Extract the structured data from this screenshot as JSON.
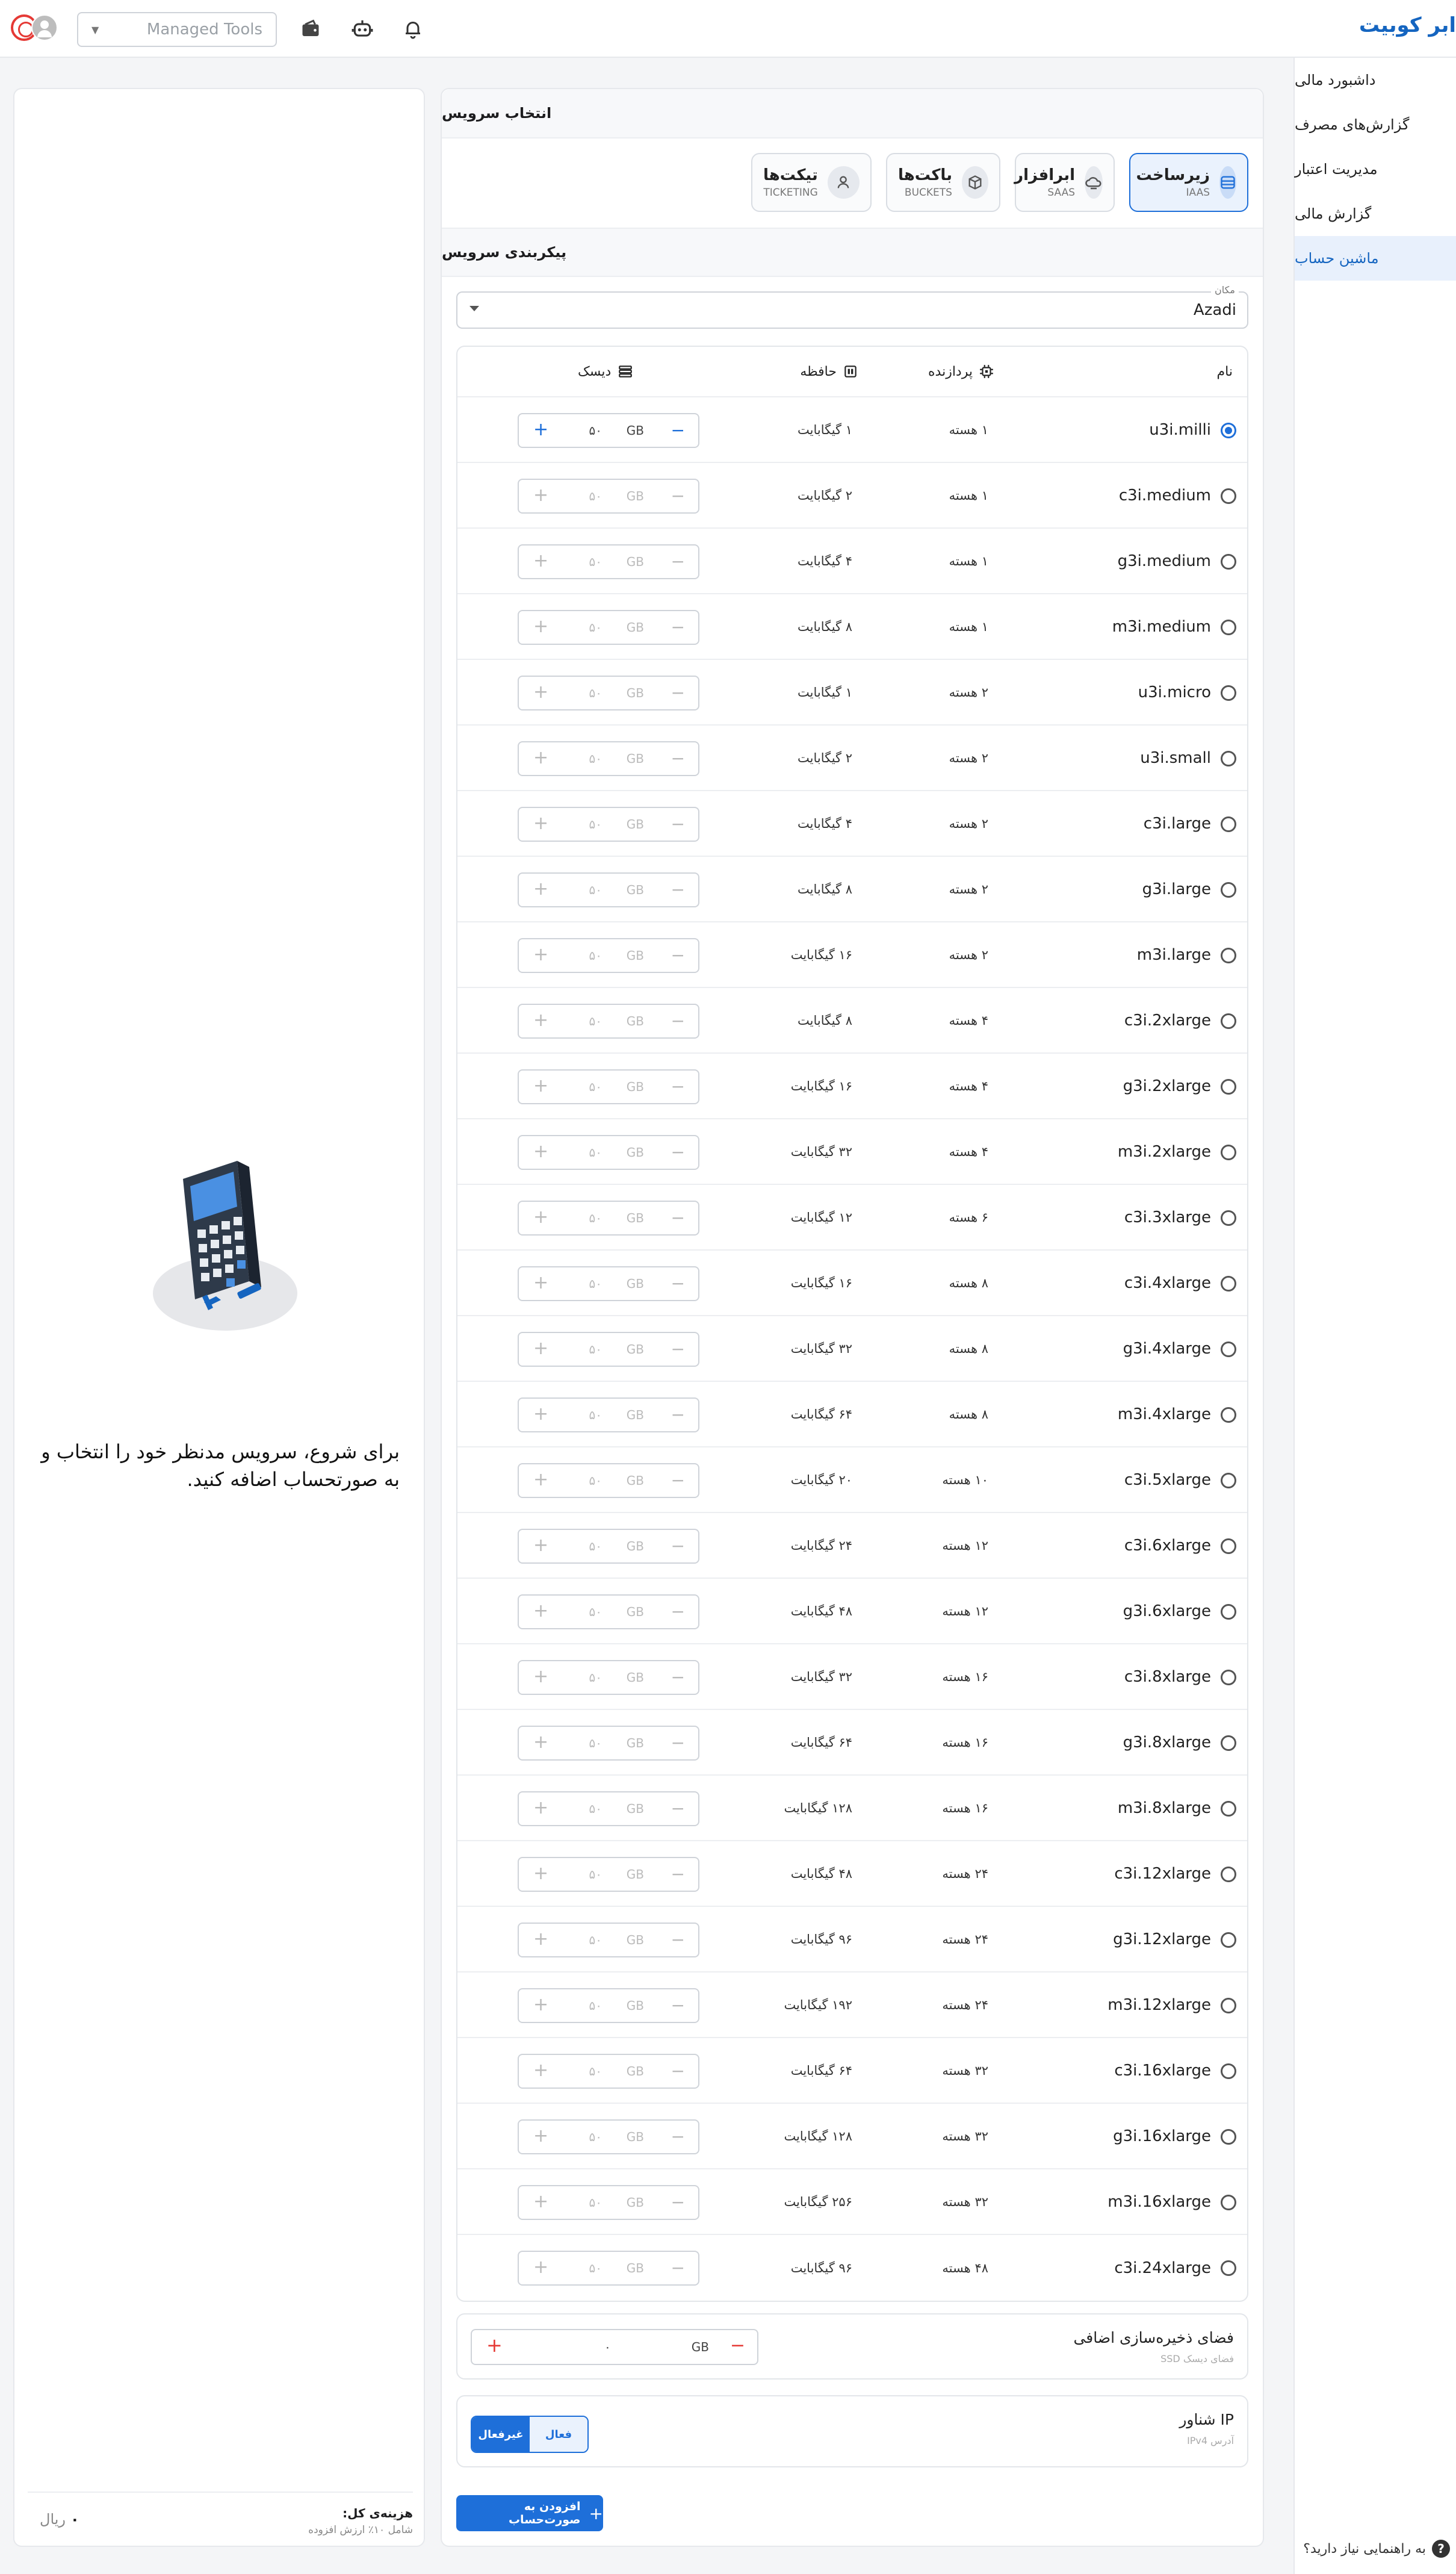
{
  "header": {
    "brand": "ابر کوبیت",
    "tools_placeholder": "Managed Tools"
  },
  "sidebar": {
    "items": [
      {
        "label": "داشبورد مالی",
        "active": false
      },
      {
        "label": "گزارش‌های مصرف",
        "active": false
      },
      {
        "label": "مدیریت اعتبار",
        "active": false
      },
      {
        "label": "گزارش مالی",
        "active": false
      },
      {
        "label": "ماشین حساب",
        "active": true
      }
    ],
    "help": "به راهنمایی نیاز دارید؟"
  },
  "main": {
    "select_service_title": "انتخاب سرویس",
    "categories": [
      {
        "title": "زیرساخت",
        "sub": "IAAS",
        "icon": "server-icon",
        "selected": true
      },
      {
        "title": "ابرافزار",
        "sub": "SAAS",
        "icon": "cloud-icon",
        "selected": false
      },
      {
        "title": "باکت‌ها",
        "sub": "BUCKETS",
        "icon": "box-icon",
        "selected": false
      },
      {
        "title": "تیکت‌ها",
        "sub": "TICKETING",
        "icon": "user-icon",
        "selected": false
      }
    ],
    "config_title": "پیکربندی سرویس",
    "location": {
      "label": "مکان",
      "value": "Azadi"
    },
    "table": {
      "headers": {
        "name": "نام",
        "cpu": "پردازنده",
        "memory": "حافظه",
        "disk": "دیسک"
      },
      "disk_unit": "GB",
      "rows": [
        {
          "name": "u3i.milli",
          "cpu": "۱ هسته",
          "mem": "۱ گیگابایت",
          "disk": "۵۰",
          "selected": true
        },
        {
          "name": "c3i.medium",
          "cpu": "۱ هسته",
          "mem": "۲ گیگابایت",
          "disk": "۵۰",
          "selected": false
        },
        {
          "name": "g3i.medium",
          "cpu": "۱ هسته",
          "mem": "۴ گیگابایت",
          "disk": "۵۰",
          "selected": false
        },
        {
          "name": "m3i.medium",
          "cpu": "۱ هسته",
          "mem": "۸ گیگابایت",
          "disk": "۵۰",
          "selected": false
        },
        {
          "name": "u3i.micro",
          "cpu": "۲ هسته",
          "mem": "۱ گیگابایت",
          "disk": "۵۰",
          "selected": false
        },
        {
          "name": "u3i.small",
          "cpu": "۲ هسته",
          "mem": "۲ گیگابایت",
          "disk": "۵۰",
          "selected": false
        },
        {
          "name": "c3i.large",
          "cpu": "۲ هسته",
          "mem": "۴ گیگابایت",
          "disk": "۵۰",
          "selected": false
        },
        {
          "name": "g3i.large",
          "cpu": "۲ هسته",
          "mem": "۸ گیگابایت",
          "disk": "۵۰",
          "selected": false
        },
        {
          "name": "m3i.large",
          "cpu": "۲ هسته",
          "mem": "۱۶ گیگابایت",
          "disk": "۵۰",
          "selected": false
        },
        {
          "name": "c3i.2xlarge",
          "cpu": "۴ هسته",
          "mem": "۸ گیگابایت",
          "disk": "۵۰",
          "selected": false
        },
        {
          "name": "g3i.2xlarge",
          "cpu": "۴ هسته",
          "mem": "۱۶ گیگابایت",
          "disk": "۵۰",
          "selected": false
        },
        {
          "name": "m3i.2xlarge",
          "cpu": "۴ هسته",
          "mem": "۳۲ گیگابایت",
          "disk": "۵۰",
          "selected": false
        },
        {
          "name": "c3i.3xlarge",
          "cpu": "۶ هسته",
          "mem": "۱۲ گیگابایت",
          "disk": "۵۰",
          "selected": false
        },
        {
          "name": "c3i.4xlarge",
          "cpu": "۸ هسته",
          "mem": "۱۶ گیگابایت",
          "disk": "۵۰",
          "selected": false
        },
        {
          "name": "g3i.4xlarge",
          "cpu": "۸ هسته",
          "mem": "۳۲ گیگابایت",
          "disk": "۵۰",
          "selected": false
        },
        {
          "name": "m3i.4xlarge",
          "cpu": "۸ هسته",
          "mem": "۶۴ گیگابایت",
          "disk": "۵۰",
          "selected": false
        },
        {
          "name": "c3i.5xlarge",
          "cpu": "۱۰ هسته",
          "mem": "۲۰ گیگابایت",
          "disk": "۵۰",
          "selected": false
        },
        {
          "name": "c3i.6xlarge",
          "cpu": "۱۲ هسته",
          "mem": "۲۴ گیگابایت",
          "disk": "۵۰",
          "selected": false
        },
        {
          "name": "g3i.6xlarge",
          "cpu": "۱۲ هسته",
          "mem": "۴۸ گیگابایت",
          "disk": "۵۰",
          "selected": false
        },
        {
          "name": "c3i.8xlarge",
          "cpu": "۱۶ هسته",
          "mem": "۳۲ گیگابایت",
          "disk": "۵۰",
          "selected": false
        },
        {
          "name": "g3i.8xlarge",
          "cpu": "۱۶ هسته",
          "mem": "۶۴ گیگابایت",
          "disk": "۵۰",
          "selected": false
        },
        {
          "name": "m3i.8xlarge",
          "cpu": "۱۶ هسته",
          "mem": "۱۲۸ گیگابایت",
          "disk": "۵۰",
          "selected": false
        },
        {
          "name": "c3i.12xlarge",
          "cpu": "۲۴ هسته",
          "mem": "۴۸ گیگابایت",
          "disk": "۵۰",
          "selected": false
        },
        {
          "name": "g3i.12xlarge",
          "cpu": "۲۴ هسته",
          "mem": "۹۶ گیگابایت",
          "disk": "۵۰",
          "selected": false
        },
        {
          "name": "m3i.12xlarge",
          "cpu": "۲۴ هسته",
          "mem": "۱۹۲ گیگابایت",
          "disk": "۵۰",
          "selected": false
        },
        {
          "name": "c3i.16xlarge",
          "cpu": "۳۲ هسته",
          "mem": "۶۴ گیگابایت",
          "disk": "۵۰",
          "selected": false
        },
        {
          "name": "g3i.16xlarge",
          "cpu": "۳۲ هسته",
          "mem": "۱۲۸ گیگابایت",
          "disk": "۵۰",
          "selected": false
        },
        {
          "name": "m3i.16xlarge",
          "cpu": "۳۲ هسته",
          "mem": "۲۵۶ گیگابایت",
          "disk": "۵۰",
          "selected": false
        },
        {
          "name": "c3i.24xlarge",
          "cpu": "۴۸ هسته",
          "mem": "۹۶ گیگابایت",
          "disk": "۵۰",
          "selected": false
        }
      ]
    },
    "extra_storage": {
      "title": "فضای ذخیره‌سازی اضافی",
      "sub": "فضای دیسک SSD",
      "unit": "GB",
      "value": "۰"
    },
    "floating_ip": {
      "title": "IP شناور",
      "sub": "آدرس IPv4",
      "on_label": "فعال",
      "off_label": "غیرفعال",
      "state": "off"
    },
    "add_button": "افزودن به صورت‌حساب"
  },
  "summary": {
    "empty_message": "برای شروع، سرویس مدنظر خود را انتخاب و به صورتحساب اضافه کنید.",
    "total_label": "هزینه‌ی کل:",
    "total_sub": "شامل ۱۰٪ ارزش افزوده",
    "total_value": "۰",
    "currency": "ریال"
  },
  "colors": {
    "accent": "#1e6fd9",
    "brand": "#1565c0",
    "danger": "#e53935"
  }
}
